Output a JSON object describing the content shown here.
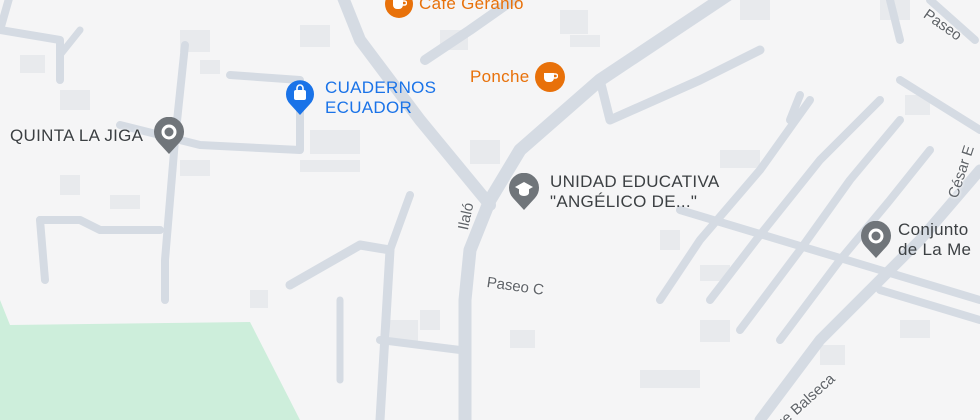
{
  "map": {
    "colors": {
      "background": "#f5f5f6",
      "road": "#d5dbe3",
      "building": "#e8eaed",
      "park": "#cdeedb",
      "poi_gray": "#70757a",
      "poi_blue": "#1a73e8",
      "poi_orange": "#e8710a",
      "label_gray": "#3c4043"
    },
    "pois": [
      {
        "id": "quinta",
        "label": "QUINTA LA JIGA",
        "icon": "location-pin-icon",
        "color": "#3c4043"
      },
      {
        "id": "cuadernos",
        "line1": "CUADERNOS",
        "line2": "ECUADOR",
        "icon": "shopping-bag-icon",
        "color": "#1a73e8"
      },
      {
        "id": "cafe",
        "label": "Café Geranio",
        "icon": "coffee-cup-icon",
        "color": "#e8710a"
      },
      {
        "id": "ponche",
        "label": "Ponche",
        "icon": "coffee-cup-icon",
        "color": "#e8710a"
      },
      {
        "id": "unidad",
        "line1": "UNIDAD EDUCATIVA",
        "line2": "\"ANGÉLICO DE...\"",
        "icon": "school-cap-icon",
        "color": "#3c4043"
      },
      {
        "id": "conjunto",
        "line1": "Conjunto",
        "line2": "de La Me",
        "icon": "location-pin-icon",
        "color": "#3c4043"
      }
    ],
    "streets": {
      "ilalo": "Ilaló",
      "paseo_c": "Paseo C",
      "paseo_top": "Paseo",
      "cesar": "César E",
      "balseca": "ue Balseca"
    }
  }
}
